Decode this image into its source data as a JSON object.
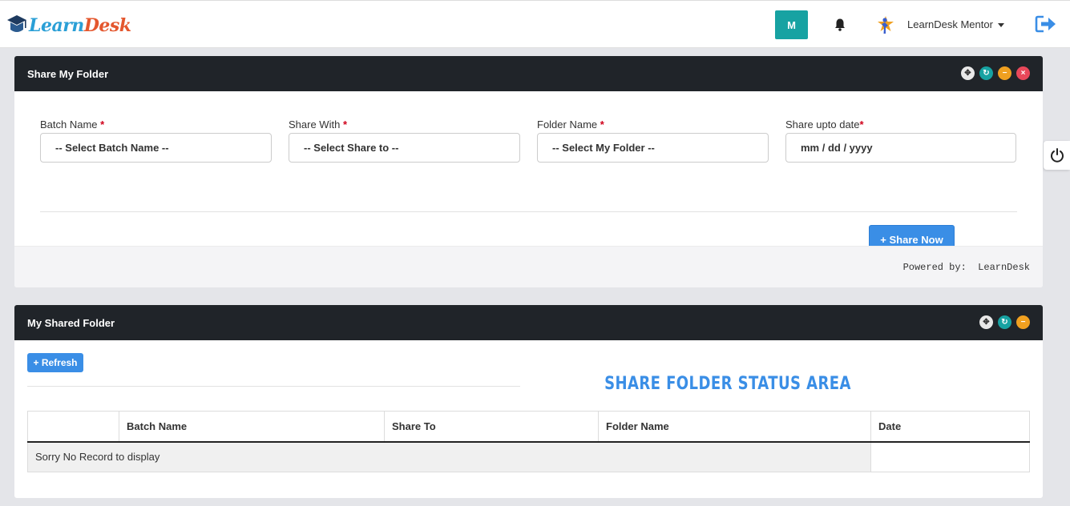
{
  "brand": {
    "part1": "Learn",
    "part2": "Desk"
  },
  "header": {
    "avatar_initial": "M",
    "user_name": "LearnDesk Mentor"
  },
  "share_panel": {
    "title": "Share My Folder",
    "fields": [
      {
        "label": "Batch Name",
        "required_mark": "*",
        "value": "-- Select Batch Name --"
      },
      {
        "label": "Share With",
        "required_mark": "*",
        "value": "-- Select Share to --"
      },
      {
        "label": "Folder Name",
        "required_mark": "*",
        "value": "-- Select My Folder --"
      },
      {
        "label": "Share upto date",
        "required_mark": "*",
        "value": "mm / dd / yyyy"
      }
    ],
    "share_button": "+ Share Now",
    "powered_by": "Powered by:  LearnDesk"
  },
  "shared_panel": {
    "title": "My Shared Folder",
    "refresh_button": "+ Refresh",
    "status_area_title": "SHARE FOLDER STATUS AREA",
    "table": {
      "columns": [
        "",
        "Batch Name",
        "Share To",
        "Folder Name",
        "Date"
      ],
      "empty_message": "Sorry No Record to display"
    }
  },
  "colors": {
    "header_dark": "#202429",
    "accent_blue": "#3a8ee6",
    "teal": "#17a2a2",
    "orange": "#f0a020",
    "red": "#e8485a",
    "required": "#d0021b"
  }
}
